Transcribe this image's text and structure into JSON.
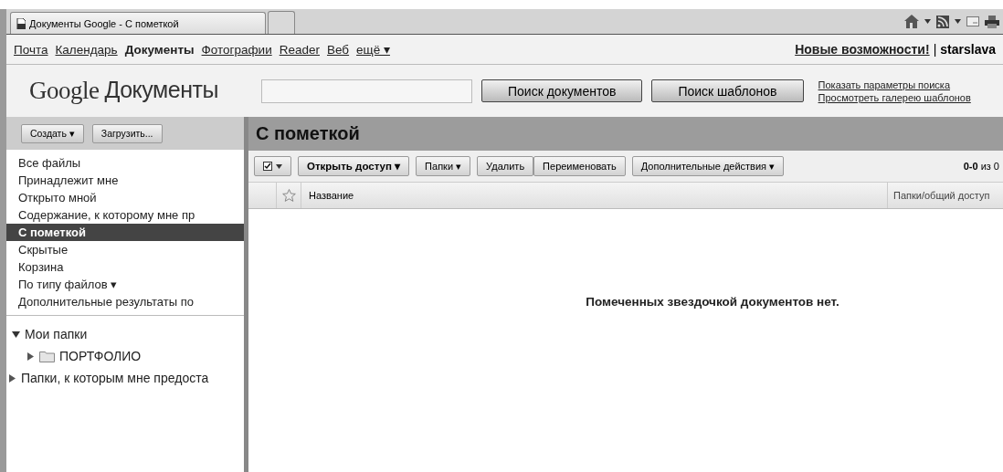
{
  "browser": {
    "tabs": [
      {
        "title": "Документы Google - С пометкой",
        "selected": true
      },
      {
        "selected": false
      }
    ]
  },
  "nav": {
    "links": [
      {
        "label": "Почта",
        "selected": false
      },
      {
        "label": "Календарь",
        "selected": false
      },
      {
        "label": "Документы",
        "selected": true
      },
      {
        "label": "Фотографии",
        "selected": false
      },
      {
        "label": "Reader",
        "selected": false
      },
      {
        "label": "Веб",
        "selected": false
      },
      {
        "label": "ещё ▾",
        "selected": false
      }
    ],
    "whats_new": "Новые возможности!",
    "separator": "|",
    "user": "starslava"
  },
  "header": {
    "logo_google": "Google",
    "logo_product": "Документы",
    "search_buttons": [
      "Поиск документов",
      "Поиск шаблонов"
    ],
    "links": [
      "Показать параметры поиска",
      "Просмотреть галерею шаблонов"
    ]
  },
  "sidebar": {
    "buttons": [
      "Создать ▾",
      "Загрузить..."
    ],
    "items": [
      {
        "label": "Все файлы",
        "selected": false
      },
      {
        "label": "Принадлежит мне",
        "selected": false
      },
      {
        "label": "Открыто мной",
        "selected": false
      },
      {
        "label": "Содержание, к которому мне пр",
        "selected": false
      },
      {
        "label": "С пометкой",
        "selected": true
      },
      {
        "label": "Скрытые",
        "selected": false
      },
      {
        "label": "Корзина",
        "selected": false
      },
      {
        "label": "По типу файлов ▾",
        "selected": false
      },
      {
        "label": "Дополнительные результаты по",
        "selected": false
      }
    ],
    "folders": [
      {
        "label": "Мои папки",
        "expanded": true,
        "children": [
          {
            "label": "ПОРТФОЛИО",
            "expanded": false
          }
        ]
      },
      {
        "label": "Папки, к которым мне предоста",
        "expanded": false
      }
    ]
  },
  "main": {
    "title": "С пометкой",
    "toolbar": [
      "Открыть доступ ▾",
      "Папки ▾",
      "Удалить",
      "Переименовать",
      "Дополнительные действия ▾"
    ],
    "count_bold": "0-0",
    "count_rest": "из 0",
    "columns": [
      "Название",
      "Папки/общий доступ"
    ],
    "empty_message": "Помеченных звездочкой документов нет."
  }
}
